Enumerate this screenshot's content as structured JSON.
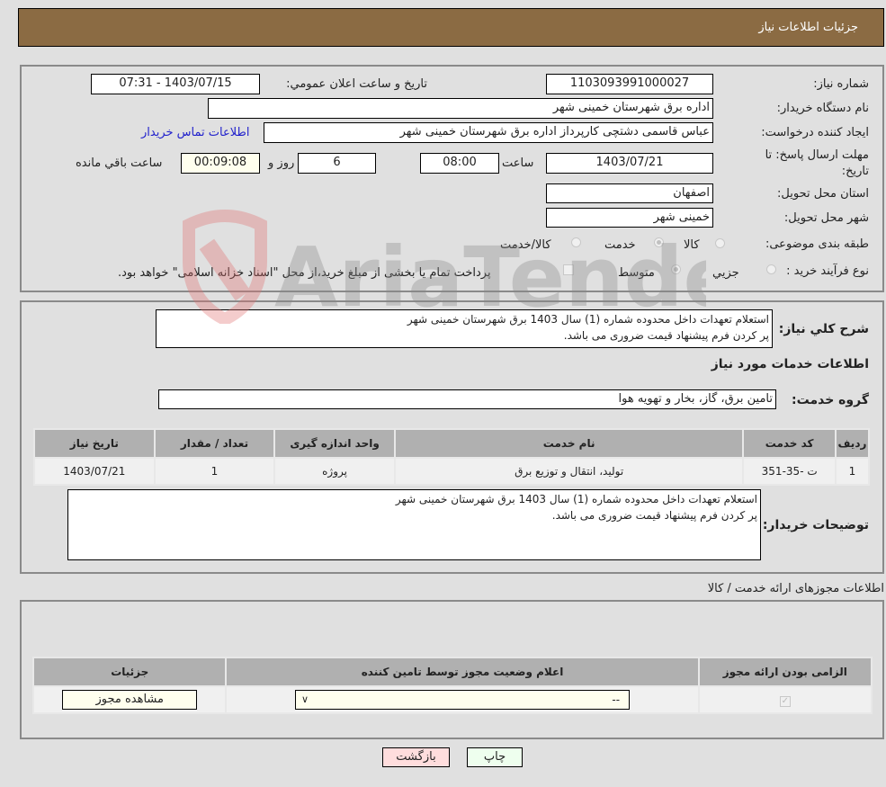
{
  "header": {
    "title": "جزئیات اطلاعات نیاز"
  },
  "form": {
    "need_number_label": "شماره نیاز:",
    "need_number": "1103093991000027",
    "announce_label": "تاریخ و ساعت اعلان عمومي:",
    "announce_value": "1403/07/15 - 07:31",
    "buyer_org_label": "نام دستگاه خريدار:",
    "buyer_org": "اداره برق شهرستان خمینی شهر",
    "creator_label": "ايجاد کننده درخواست:",
    "creator": "عباس قاسمی دشتچی کارپرداز اداره برق شهرستان خمینی شهر",
    "contact_link": "اطلاعات تماس خریدار",
    "deadline_label": "مهلت ارسال پاسخ: تا تاريخ:",
    "deadline_date": "1403/07/21",
    "time_label": "ساعت",
    "deadline_time": "08:00",
    "days_value": "6",
    "days_label": "روز و",
    "remaining_time": "00:09:08",
    "remaining_label": "ساعت باقي مانده",
    "province_label": "استان محل تحويل:",
    "province": "اصفهان",
    "city_label": "شهر محل تحويل:",
    "city": "خمینی شهر",
    "category_label": "طبقه بندی موضوعی:",
    "category_options": [
      "کالا",
      "خدمت",
      "کالا/خدمت"
    ],
    "category_selected": "خدمت",
    "process_label": "نوع فرآیند خرید :",
    "process_options": [
      "جزيي",
      "متوسط"
    ],
    "process_selected": "متوسط",
    "treasury_note": "پرداخت تمام یا بخشی از مبلغ خرید،از محل \"اسناد خزانه اسلامی\" خواهد بود."
  },
  "description": {
    "label": "شرح کلي نياز:",
    "text": "استعلام تعهدات داخل محدوده شماره (1) سال 1403 برق شهرستان خمینی شهر\nپر کردن فرم پیشنهاد قیمت ضروری می باشد."
  },
  "services": {
    "section_title": "اطلاعات خدمات مورد نياز",
    "group_label": "گروه خدمت:",
    "group_value": "تامین برق، گاز، بخار و تهویه هوا",
    "columns": [
      "رديف",
      "کد خدمت",
      "نام خدمت",
      "واحد اندازه گيری",
      "تعداد / مقدار",
      "تاريخ نياز"
    ],
    "rows": [
      [
        "1",
        "ت -35-351",
        "تولید، انتقال و توزیع برق",
        "پروژه",
        "1",
        "1403/07/21"
      ]
    ]
  },
  "buyer_notes": {
    "label": "توضيحات خريدار:",
    "text": "استعلام تعهدات داخل محدوده شماره (1) سال 1403 برق شهرستان خمینی شهر\nپر کردن فرم پیشنهاد قیمت ضروری می باشد."
  },
  "permits": {
    "section_title": "اطلاعات مجوزهای ارائه خدمت / کالا",
    "columns": [
      "الزامی بودن ارائه مجوز",
      "اعلام وضعیت مجوز توسط تامین کننده",
      "جزئيات"
    ],
    "row": {
      "required_checked": true,
      "status_value": "--",
      "view_button": "مشاهده مجوز"
    }
  },
  "buttons": {
    "print": "چاپ",
    "back": "بازگشت"
  },
  "watermark": {
    "text": "AriaTender.neT"
  },
  "colors": {
    "header_bg": "#8b6b43",
    "print_bg": "#eeffee",
    "back_bg": "#ffdddd",
    "link": "#2222cc"
  }
}
